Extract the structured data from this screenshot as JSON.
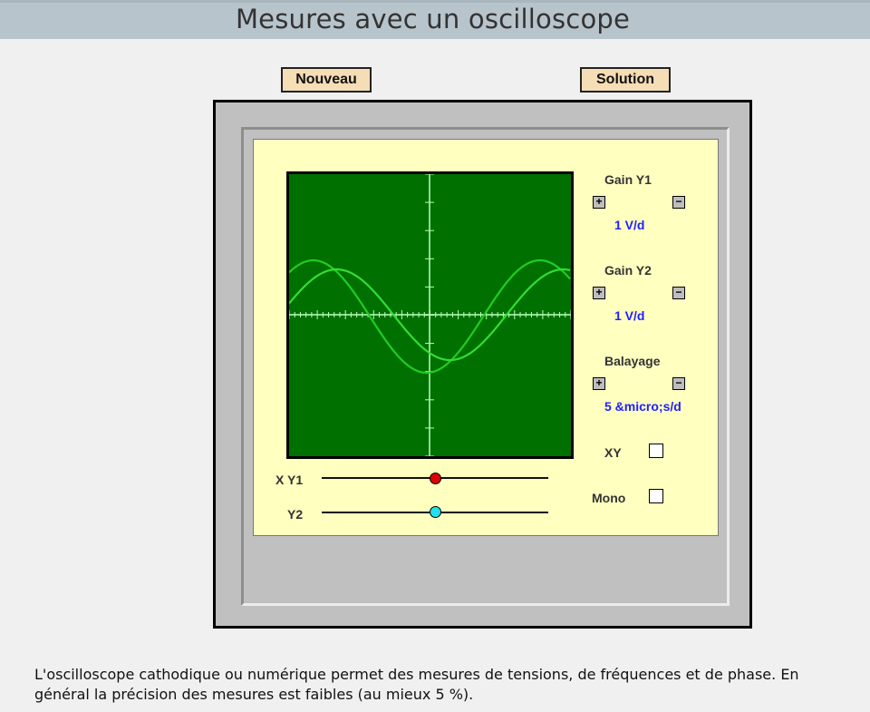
{
  "page": {
    "title": "Mesures avec un oscilloscope",
    "description": "L'oscilloscope cathodique ou numérique permet des mesures de tensions, de fréquences et de phase. En général la précision des mesures est faibles (au mieux 5 %)."
  },
  "buttons": {
    "new_label": "Nouveau",
    "solution_label": "Solution"
  },
  "controls": {
    "gain_y1": {
      "label": "Gain Y1",
      "plus": "+",
      "minus": "−",
      "value": "1 V/d"
    },
    "gain_y2": {
      "label": "Gain Y2",
      "plus": "+",
      "minus": "−",
      "value": "1 V/d"
    },
    "sweep": {
      "label": "Balayage",
      "plus": "+",
      "minus": "−",
      "value": "5 &micro;s/d"
    },
    "xy": {
      "label": "XY",
      "checked": false
    },
    "mono": {
      "label": "Mono",
      "checked": false
    }
  },
  "sliders": {
    "xy1": {
      "label": "X Y1",
      "position": 0.5,
      "color": "#dd0000"
    },
    "y2": {
      "label": "Y2",
      "position": 0.5,
      "color": "#22e0ee"
    }
  },
  "colors": {
    "screen": "#007000",
    "graticule": "#b8ffb8",
    "trace1": "#22cc22",
    "trace2": "#33dd33",
    "panel": "#ffffc0",
    "button": "#f5ddb5",
    "value_text": "#2020ff"
  }
}
